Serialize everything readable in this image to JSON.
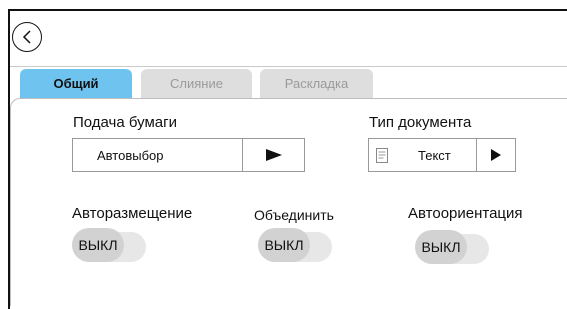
{
  "header": {
    "back_icon": "back-arrow-icon"
  },
  "tabs": [
    {
      "label": "Общий",
      "active": true
    },
    {
      "label": "Слияние",
      "active": false
    },
    {
      "label": "Раскладка",
      "active": false
    }
  ],
  "paper_feed": {
    "label": "Подача бумаги",
    "value": "Автовыбор",
    "arrow_icon": "play-arrow-icon"
  },
  "doc_type": {
    "label": "Тип документа",
    "value": "Текст",
    "doc_icon": "document-icon",
    "arrow_icon": "play-arrow-icon"
  },
  "toggles": [
    {
      "label": "Авторазмещение",
      "state": "ВЫКЛ"
    },
    {
      "label": "Объединить",
      "state": "ВЫКЛ"
    },
    {
      "label": "Автоориентация",
      "state": "ВЫКЛ"
    }
  ],
  "colors": {
    "active_tab": "#6fc3ef",
    "inactive_tab": "#dedede",
    "toggle_knob": "#d2d2d2"
  }
}
